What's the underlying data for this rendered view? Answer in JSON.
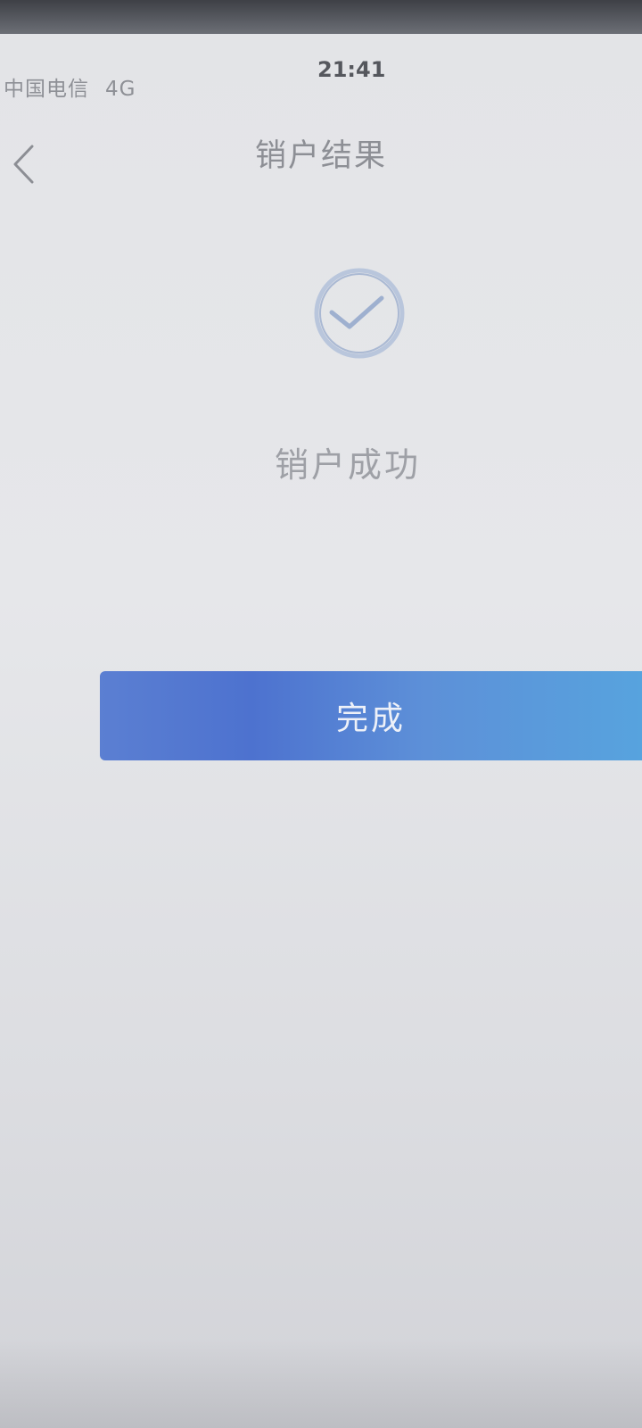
{
  "status_bar": {
    "carrier": "中国电信",
    "network": "4G",
    "time": "21:41"
  },
  "nav": {
    "title": "销户结果",
    "back_icon": "chevron-left-icon"
  },
  "result": {
    "icon": "check-circle-icon",
    "message": "销户成功"
  },
  "actions": {
    "done_label": "完成"
  },
  "colors": {
    "accent": "#5b86d6",
    "icon_stroke": "#a9b9d4",
    "background": "#e4e5e8"
  }
}
